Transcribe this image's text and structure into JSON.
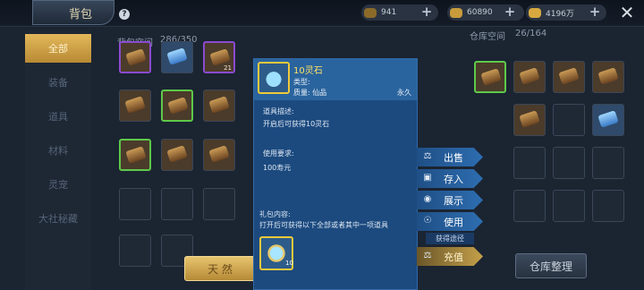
{
  "header": {
    "title": "背包",
    "help_icon": "?"
  },
  "currencies": [
    {
      "name": "coin-currency",
      "value": "941",
      "color": "#8b6a2a"
    },
    {
      "name": "gold-ingot-currency",
      "value": "60890",
      "color": "#c79a3c"
    },
    {
      "name": "gold-bar-currency",
      "value": "4196万",
      "color": "#d8a840"
    }
  ],
  "sidebar": {
    "items": [
      {
        "label": "全部",
        "active": true
      },
      {
        "label": "装备",
        "active": false
      },
      {
        "label": "道具",
        "active": false
      },
      {
        "label": "材料",
        "active": false
      },
      {
        "label": "灵宠",
        "active": false
      },
      {
        "label": "大社秘藏",
        "active": false
      }
    ]
  },
  "bag": {
    "label": "背包空间",
    "capacity": "286/350",
    "arrange_label": "天 然"
  },
  "warehouse": {
    "label": "仓库空间",
    "capacity": "26/164",
    "arrange_label": "仓库整理"
  },
  "tooltip": {
    "name": "10灵石",
    "type_label": "类型:",
    "quality_label": "质量: 仙品",
    "duration": "永久",
    "desc_title": "道具描述:",
    "desc_text": "开启后可获得10灵石",
    "req_title": "使用要求:",
    "req_text": "100寿元",
    "gift_title": "礼包内容:",
    "gift_text": "打开后可获得以下全部或者其中一项道具",
    "gift_count": "10"
  },
  "actions": [
    {
      "label": "出售",
      "icon": "scale-icon"
    },
    {
      "label": "存入",
      "icon": "box-icon"
    },
    {
      "label": "展示",
      "icon": "show-icon"
    },
    {
      "label": "使用",
      "icon": "use-icon"
    },
    {
      "label": "充值",
      "icon": "scale-icon"
    }
  ],
  "source_label": "获得途径",
  "bag_counts": [
    "21",
    "21"
  ]
}
